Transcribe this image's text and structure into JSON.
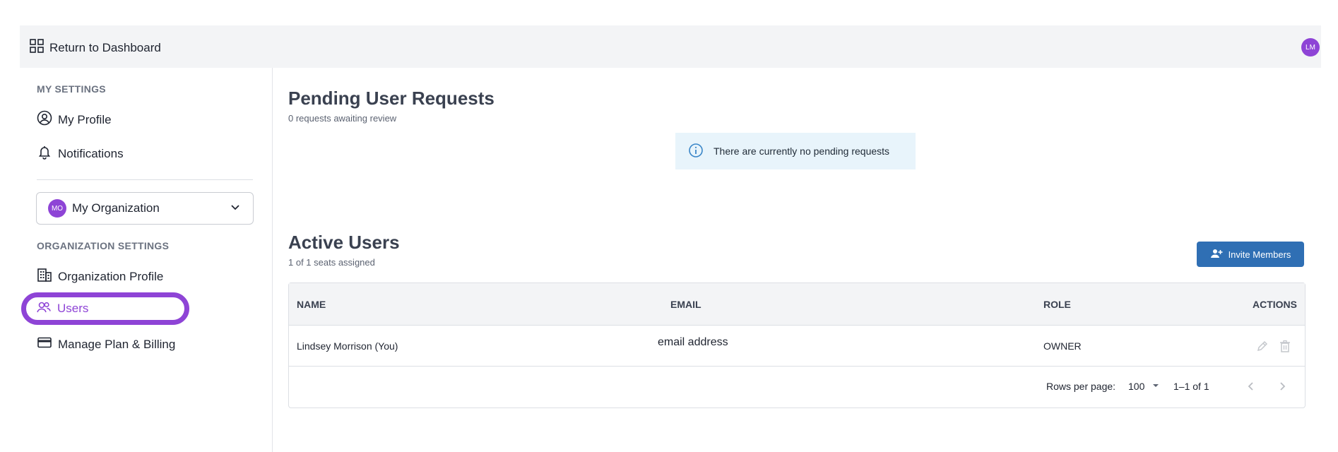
{
  "topbar": {
    "return_label": "Return to Dashboard",
    "avatar_initials": "LM"
  },
  "sidebar": {
    "my_settings_label": "MY SETTINGS",
    "my_profile": "My Profile",
    "notifications": "Notifications",
    "org_avatar": "MO",
    "org_name": "My Organization",
    "org_settings_label": "ORGANIZATION SETTINGS",
    "org_profile": "Organization Profile",
    "users": "Users",
    "billing": "Manage Plan & Billing"
  },
  "pending": {
    "title": "Pending User Requests",
    "subtitle": "0 requests awaiting review",
    "empty_message": "There are currently no pending requests"
  },
  "active": {
    "title": "Active Users",
    "subtitle": "1 of 1 seats assigned",
    "invite_label": "Invite Members",
    "columns": {
      "name": "NAME",
      "email": "EMAIL",
      "role": "ROLE",
      "actions": "ACTIONS"
    },
    "rows": [
      {
        "name": "Lindsey Morrison (You)",
        "email": "email address",
        "role": "OWNER"
      }
    ],
    "rows_per_page_label": "Rows per page:",
    "rows_per_page_value": "100",
    "range": "1–1 of 1"
  },
  "colors": {
    "accent": "#8e44d6",
    "primary": "#2f6fb4",
    "info_bg": "#e8f4fb"
  }
}
